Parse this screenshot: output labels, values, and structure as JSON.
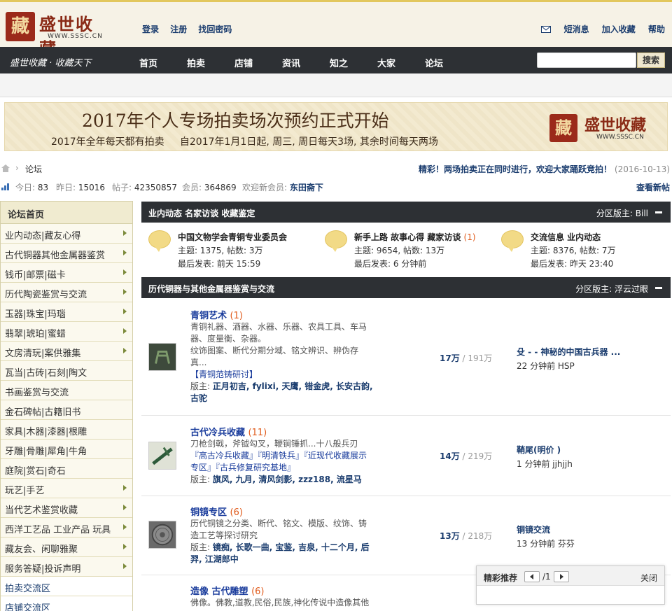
{
  "header": {
    "logo_text": "盛世收藏",
    "logo_seal": "藏",
    "logo_url": "WWW.SSSC.CN",
    "links": [
      "登录",
      "注册",
      "找回密码"
    ],
    "right_links": [
      "短消息",
      "加入收藏",
      "帮助"
    ]
  },
  "nav": {
    "slogan": "盛世收藏 · 收藏天下",
    "items": [
      "首页",
      "拍卖",
      "店铺",
      "资讯",
      "知之",
      "大家",
      "论坛"
    ],
    "search_button": "搜索"
  },
  "banner": {
    "title": "2017年个人专场拍卖场次预约正式开始",
    "subtitle": "2017年全年每天都有拍卖     自2017年1月1日起, 周三, 周日每天3场, 其余时间每天两场",
    "logo_text": "盛世收藏",
    "logo_seal": "藏",
    "logo_url": "WWW.SSSC.CN"
  },
  "breadcrumb": {
    "sep": "›",
    "label": "论坛"
  },
  "announcement": {
    "text": "精彩！两场拍卖正在同时进行，欢迎大家踊跃竞拍！",
    "date": "(2016-10-13)"
  },
  "stats": {
    "today_label": "今日:",
    "today": "83",
    "yesterday_label": "昨日:",
    "yesterday": "15016",
    "posts_label": "帖子:",
    "posts": "42350857",
    "members_label": "会员:",
    "members": "364869",
    "welcome_label": "欢迎新会员:",
    "newest_member": "东田斋下",
    "view_new": "查看新帖"
  },
  "sidebar": {
    "title": "论坛首页",
    "items": [
      "业内动态|藏友心得",
      "古代铜器其他金属器鉴赏",
      "钱币|邮票|磁卡",
      "历代陶瓷鉴赏与交流",
      "玉器|珠宝|玛瑙",
      "翡翠|琥珀|蜜蜡",
      "文房清玩|案供雅集",
      "瓦当|古砖|石刻|陶文",
      "书画鉴赏与交流",
      "金石碑帖|古籍旧书",
      "家具|木器|漆器|根雕",
      "牙雕|骨雕|犀角|牛角",
      "庭院|赏石|奇石",
      "玩艺|手艺",
      "当代艺术鉴赏收藏",
      "西洋工艺品 工业产品 玩具",
      "藏友会、闲聊雅聚",
      "服务答疑|投诉声明"
    ],
    "links": [
      "拍卖交流区",
      "店铺交流区"
    ]
  },
  "section1": {
    "title": "业内动态 名家访谈 收藏鉴定",
    "moderator": "分区版主: Bill",
    "cats": [
      {
        "name": "中国文物学会青铜专业委员会",
        "new": "",
        "meta1": "主题: 1375, 帖数: 3万",
        "meta2": "最后发表: 前天 15:59"
      },
      {
        "name": "新手上路 故事心得 藏家访谈",
        "new": "(1)",
        "meta1": "主题: 9654, 帖数: 13万",
        "meta2": "最后发表: 6 分钟前"
      },
      {
        "name": "交流信息 业内动态",
        "new": "",
        "meta1": "主题: 8376, 帖数: 7万",
        "meta2": "最后发表: 昨天 23:40"
      }
    ]
  },
  "section2": {
    "title": "历代铜器与其他金属器鉴赏与交流",
    "moderator": "分区版主: 浮云过眼"
  },
  "forums": [
    {
      "title": "青铜艺术",
      "count": "(1)",
      "desc": "青铜礼器、酒器、水器、乐器、农具工具、车马器、度量衡、杂器。",
      "desc2": "纹饰图案、断代分期分域、铭文辨识、辨伪存真...",
      "tags": "【青铜范铸研讨】",
      "mods_label": "版主:",
      "mods": "正月初吉, fylixi, 天鹰, 错金虎, 长安古韵, 古驼",
      "topics": "17万",
      "posts": "/ 191万",
      "last_title": "殳 - - 神秘的中国古兵器 ...",
      "last_meta": "22 分钟前 HSP"
    },
    {
      "title": "古代冷兵收藏",
      "count": "(11)",
      "desc": "刀枪剑戟，斧钺勾叉，鞭锏锤抓...十八般兵刃",
      "tags": "『高古冷兵收藏』『明清铁兵』『近现代收藏展示专区』『古兵修复研究基地』",
      "mods_label": "版主:",
      "mods": "旗风, 九月, 清风剑影, zzz188, 流星马",
      "topics": "14万",
      "posts": "/ 219万",
      "last_title": "鞘尾(明价 )",
      "last_meta": "1 分钟前 jjhjjh"
    },
    {
      "title": "铜镜专区",
      "count": "(6)",
      "desc": "历代铜镜之分类、断代、铭文、模版、纹饰、铸造工艺等探讨研究",
      "mods_label": "版主:",
      "mods": "镜痴, 长歌一曲, 宝鉴, 吉泉, 十二个月, 后羿, 江湖郎中",
      "topics": "13万",
      "posts": "/ 218万",
      "last_title": "铜镜交流",
      "last_meta": "13 分钟前 芬芬"
    },
    {
      "title": "造像 古代雕塑",
      "count": "(6)",
      "desc": "佛像。佛教,道教,民俗,民族,神化传说中造像其他"
    }
  ],
  "popup": {
    "title": "精彩推荐",
    "page": "/1",
    "close": "关闭"
  },
  "colors": {
    "nav_bg": "#2d3034",
    "link_blue": "#1a3c6e",
    "accent_red": "#9b2a1a",
    "banner_bg": "#f3ead0"
  }
}
